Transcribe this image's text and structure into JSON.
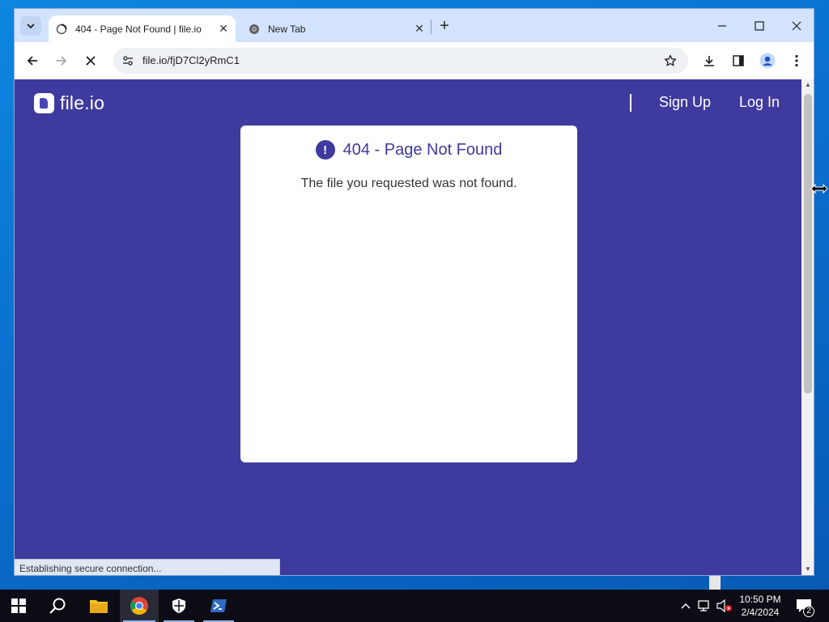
{
  "browser": {
    "tabs": [
      {
        "title": "404 - Page Not Found | file.io",
        "active": true
      },
      {
        "title": "New Tab",
        "active": false
      }
    ],
    "url": "file.io/fjD7Cl2yRmC1",
    "status": "Establishing secure connection..."
  },
  "site": {
    "logo_text": "file.io",
    "nav": {
      "signup": "Sign Up",
      "login": "Log In"
    }
  },
  "error": {
    "icon": "!",
    "title": "404 - Page Not Found",
    "message": "The file you requested was not found."
  },
  "taskbar": {
    "time": "10:50 PM",
    "date": "2/4/2024",
    "notification_count": "2",
    "apps": [
      "start-icon",
      "search-icon",
      "file-explorer-icon",
      "chrome-icon",
      "security-icon",
      "powershell-icon"
    ]
  },
  "colors": {
    "brand": "#3f3a9e",
    "tabbar": "#d3e3fd",
    "desktop": "#0a78d4"
  }
}
